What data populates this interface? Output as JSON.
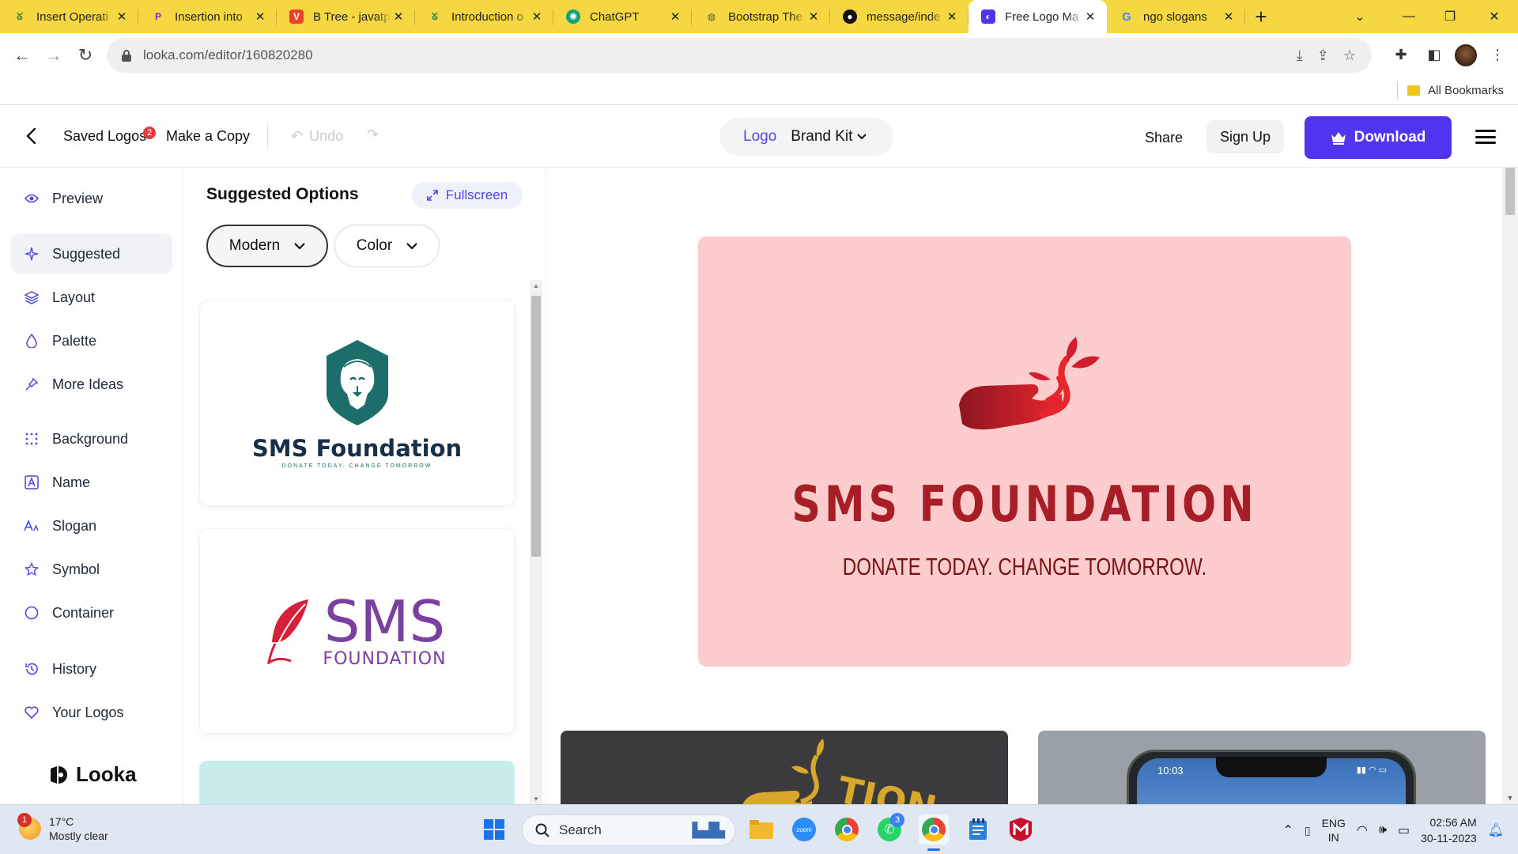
{
  "browser": {
    "tabs": [
      {
        "title": "Insert Operati",
        "favicon": "gfg-icon",
        "color": "#2f8d46"
      },
      {
        "title": "Insertion into",
        "favicon": "p-icon",
        "color": "#7b2cbf"
      },
      {
        "title": "B Tree - javatp",
        "favicon": "v-icon",
        "color": "#e8412c"
      },
      {
        "title": "Introduction o",
        "favicon": "gfg-icon",
        "color": "#2f8d46"
      },
      {
        "title": "ChatGPT",
        "favicon": "chatgpt-icon",
        "color": "#10a37f"
      },
      {
        "title": "Bootstrap The",
        "favicon": "globe-icon",
        "color": "#555555"
      },
      {
        "title": "message/inde",
        "favicon": "github-icon",
        "color": "#111111"
      },
      {
        "title": "Free Logo Ma",
        "favicon": "looka-icon",
        "color": "#4f35f0",
        "active": true
      },
      {
        "title": "ngo slogans",
        "favicon": "google-icon",
        "color": "#4285f4"
      }
    ],
    "url": "looka.com/editor/160820280",
    "bookmarks_label": "All Bookmarks"
  },
  "header": {
    "saved_logos": "Saved Logos",
    "saved_badge": "2",
    "make_copy": "Make a Copy",
    "undo": "Undo",
    "mode_logo": "Logo",
    "mode_brand_kit": "Brand Kit",
    "share": "Share",
    "sign_up": "Sign Up",
    "download": "Download"
  },
  "sidebar": {
    "items": [
      {
        "label": "Preview",
        "icon": "eye-icon"
      },
      {
        "label": "Suggested",
        "icon": "sparkle-icon",
        "active": true
      },
      {
        "label": "Layout",
        "icon": "layers-icon"
      },
      {
        "label": "Palette",
        "icon": "drop-icon"
      },
      {
        "label": "More Ideas",
        "icon": "pin-icon"
      },
      {
        "label": "Background",
        "icon": "grid-icon"
      },
      {
        "label": "Name",
        "icon": "name-icon"
      },
      {
        "label": "Slogan",
        "icon": "slogan-icon"
      },
      {
        "label": "Symbol",
        "icon": "star-icon"
      },
      {
        "label": "Container",
        "icon": "circle-icon"
      },
      {
        "label": "History",
        "icon": "history-icon"
      },
      {
        "label": "Your Logos",
        "icon": "heart-icon"
      }
    ],
    "brand": "Looka"
  },
  "options": {
    "title": "Suggested Options",
    "fullscreen": "Fullscreen",
    "filters": [
      {
        "label": "Modern",
        "selected": true
      },
      {
        "label": "Color",
        "selected": false
      }
    ],
    "cards": [
      {
        "name": "SMS Foundation",
        "slogan": "DONATE TODAY. CHANGE TOMORROW",
        "color": "#1c6e6a"
      },
      {
        "name_top": "SMS",
        "name_bottom": "FOUNDATION",
        "color": "#7b3fa0",
        "accent": "#d6203a"
      }
    ]
  },
  "preview": {
    "name": "SMS FOUNDATION",
    "slogan": "DONATE TODAY. CHANGE TOMORROW.",
    "background": "#fdcdcd",
    "name_color": "#a81e26",
    "mockup_text": "TION",
    "phone_time": "10:03"
  },
  "taskbar": {
    "temperature": "17°C",
    "weather": "Mostly clear",
    "weather_badge": "1",
    "search": "Search",
    "whatsapp_badge": "3",
    "lang_top": "ENG",
    "lang_bottom": "IN",
    "time": "02:56 AM",
    "date": "30-11-2023"
  }
}
